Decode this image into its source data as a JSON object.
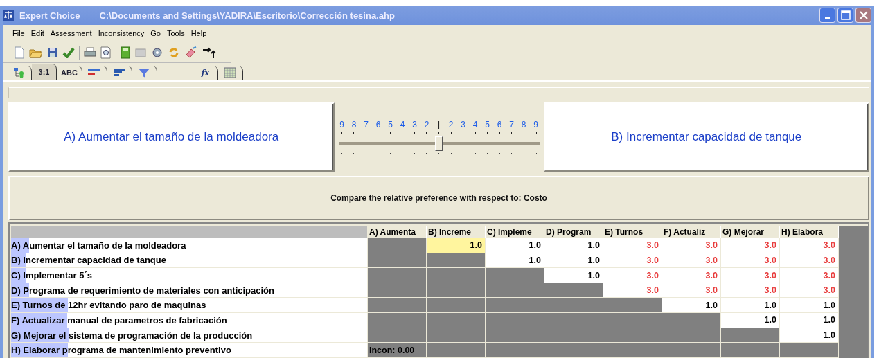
{
  "window": {
    "app_name": "Expert Choice",
    "path": "C:\\Documents and Settings\\YADIRA\\Escritorio\\Corrección tesina.ahp"
  },
  "menu": [
    "File",
    "Edit",
    "Assessment",
    "Inconsistency",
    "Go",
    "Tools",
    "Help"
  ],
  "tabs": [
    {
      "kind": "tree",
      "selected": false
    },
    {
      "kind": "text",
      "label": "3:1",
      "selected": true
    },
    {
      "kind": "text",
      "label": "ABC",
      "selected": false
    },
    {
      "kind": "bars-red",
      "selected": false
    },
    {
      "kind": "bars-blue",
      "selected": false
    },
    {
      "kind": "funnel",
      "selected": false
    },
    {
      "kind": "formula",
      "label": "fx",
      "selected": false
    },
    {
      "kind": "grid",
      "selected": false
    }
  ],
  "comparison": {
    "left": "A) Aumentar el tamaño de la moldeadora",
    "right": "B) Incrementar capacidad de tanque",
    "scale": [
      "9",
      "8",
      "7",
      "6",
      "5",
      "4",
      "3",
      "2",
      "|",
      "2",
      "3",
      "4",
      "5",
      "6",
      "7",
      "8",
      "9"
    ],
    "level": 0.5
  },
  "question": "Compare the relative preference with respect to: Costo",
  "matrix": {
    "columns": [
      "A) Aumenta",
      "B) Increme",
      "C) Impleme",
      "D) Program",
      "E) Turnos",
      "F) Actualiz",
      "G) Mejorar",
      "H) Elabora"
    ],
    "rows": [
      {
        "marked": "A) A",
        "rest": "umentar el tamaño de la moldeadora",
        "cells": [
          {
            "kind": "blank"
          },
          {
            "kind": "value",
            "text": "1.0",
            "inverted": false,
            "selected": true
          },
          {
            "kind": "value",
            "text": "1.0",
            "inverted": false,
            "selected": false
          },
          {
            "kind": "value",
            "text": "1.0",
            "inverted": false,
            "selected": false
          },
          {
            "kind": "value",
            "text": "3.0",
            "inverted": true,
            "selected": false
          },
          {
            "kind": "value",
            "text": "3.0",
            "inverted": true,
            "selected": false
          },
          {
            "kind": "value",
            "text": "3.0",
            "inverted": true,
            "selected": false
          },
          {
            "kind": "value",
            "text": "3.0",
            "inverted": true,
            "selected": false
          }
        ]
      },
      {
        "marked": "B) I",
        "rest": "ncrementar capacidad de tanque",
        "cells": [
          {
            "kind": "blank"
          },
          {
            "kind": "blank"
          },
          {
            "kind": "value",
            "text": "1.0",
            "inverted": false,
            "selected": false
          },
          {
            "kind": "value",
            "text": "1.0",
            "inverted": false,
            "selected": false
          },
          {
            "kind": "value",
            "text": "3.0",
            "inverted": true,
            "selected": false
          },
          {
            "kind": "value",
            "text": "3.0",
            "inverted": true,
            "selected": false
          },
          {
            "kind": "value",
            "text": "3.0",
            "inverted": true,
            "selected": false
          },
          {
            "kind": "value",
            "text": "3.0",
            "inverted": true,
            "selected": false
          }
        ]
      },
      {
        "marked": "C) I",
        "rest": "mplementar 5´s",
        "cells": [
          {
            "kind": "blank"
          },
          {
            "kind": "blank"
          },
          {
            "kind": "blank"
          },
          {
            "kind": "value",
            "text": "1.0",
            "inverted": false,
            "selected": false
          },
          {
            "kind": "value",
            "text": "3.0",
            "inverted": true,
            "selected": false
          },
          {
            "kind": "value",
            "text": "3.0",
            "inverted": true,
            "selected": false
          },
          {
            "kind": "value",
            "text": "3.0",
            "inverted": true,
            "selected": false
          },
          {
            "kind": "value",
            "text": "3.0",
            "inverted": true,
            "selected": false
          }
        ]
      },
      {
        "marked": "D) P",
        "rest": "rograma de requerimiento de materiales con anticipación",
        "cells": [
          {
            "kind": "blank"
          },
          {
            "kind": "blank"
          },
          {
            "kind": "blank"
          },
          {
            "kind": "blank"
          },
          {
            "kind": "value",
            "text": "3.0",
            "inverted": true,
            "selected": false
          },
          {
            "kind": "value",
            "text": "3.0",
            "inverted": true,
            "selected": false
          },
          {
            "kind": "value",
            "text": "3.0",
            "inverted": true,
            "selected": false
          },
          {
            "kind": "value",
            "text": "3.0",
            "inverted": true,
            "selected": false
          }
        ]
      },
      {
        "marked": "E) Turnos de ",
        "rest": "12hr evitando paro de maquinas",
        "cells": [
          {
            "kind": "blank"
          },
          {
            "kind": "blank"
          },
          {
            "kind": "blank"
          },
          {
            "kind": "blank"
          },
          {
            "kind": "blank"
          },
          {
            "kind": "value",
            "text": "1.0",
            "inverted": false,
            "selected": false
          },
          {
            "kind": "value",
            "text": "1.0",
            "inverted": false,
            "selected": false
          },
          {
            "kind": "value",
            "text": "1.0",
            "inverted": false,
            "selected": false
          }
        ]
      },
      {
        "marked": "F) Actualizar ",
        "rest": "manual de parametros de fabricación",
        "cells": [
          {
            "kind": "blank"
          },
          {
            "kind": "blank"
          },
          {
            "kind": "blank"
          },
          {
            "kind": "blank"
          },
          {
            "kind": "blank"
          },
          {
            "kind": "blank"
          },
          {
            "kind": "value",
            "text": "1.0",
            "inverted": false,
            "selected": false
          },
          {
            "kind": "value",
            "text": "1.0",
            "inverted": false,
            "selected": false
          }
        ]
      },
      {
        "marked": "G) Mejorar el ",
        "rest": "sistema de programación de la producción",
        "cells": [
          {
            "kind": "blank"
          },
          {
            "kind": "blank"
          },
          {
            "kind": "blank"
          },
          {
            "kind": "blank"
          },
          {
            "kind": "blank"
          },
          {
            "kind": "blank"
          },
          {
            "kind": "blank"
          },
          {
            "kind": "value",
            "text": "1.0",
            "inverted": false,
            "selected": false
          }
        ]
      },
      {
        "marked": "H) Elaborar p",
        "rest": "rograma de mantenimiento preventivo",
        "cells": [
          {
            "kind": "note",
            "text": "Incon: 0.00"
          },
          {
            "kind": "blank"
          },
          {
            "kind": "blank"
          },
          {
            "kind": "blank"
          },
          {
            "kind": "blank"
          },
          {
            "kind": "blank"
          },
          {
            "kind": "blank"
          },
          {
            "kind": "blank"
          }
        ]
      }
    ]
  }
}
